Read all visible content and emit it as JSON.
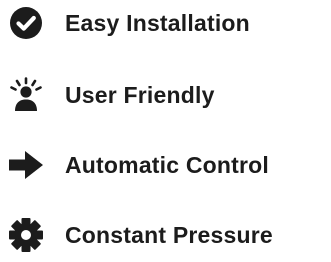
{
  "features": [
    {
      "label": "Easy Installation",
      "icon": "check-circle-icon"
    },
    {
      "label": "User Friendly",
      "icon": "user-idea-icon"
    },
    {
      "label": "Automatic Control",
      "icon": "arrow-right-icon"
    },
    {
      "label": "Constant Pressure",
      "icon": "gear-icon"
    }
  ],
  "colors": {
    "icon": "#1c1c1c",
    "text": "#1c1c1c",
    "background": "#ffffff"
  }
}
